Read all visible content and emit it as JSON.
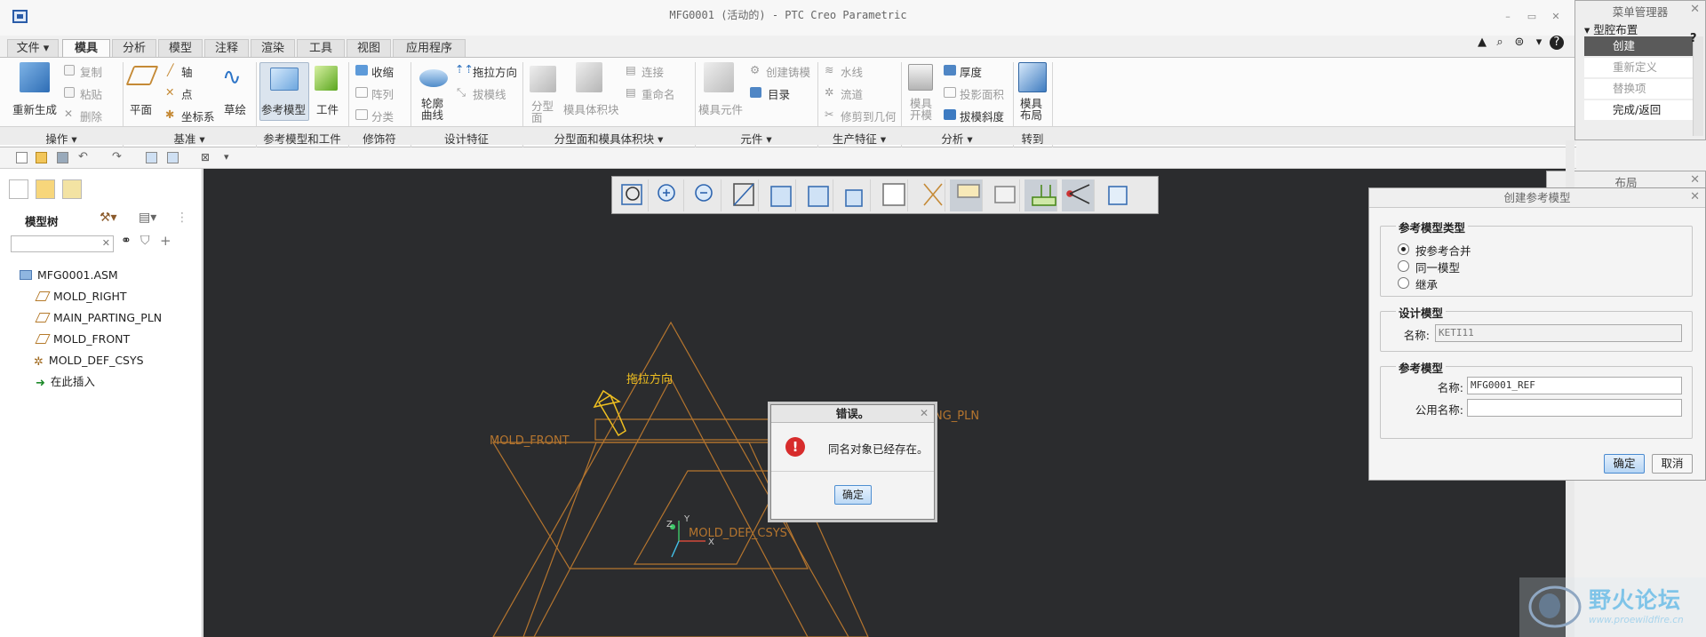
{
  "window": {
    "title": "MFG0001 (活动的) - PTC Creo Parametric"
  },
  "tabs": [
    "文件",
    "模具",
    "分析",
    "模型",
    "注释",
    "渲染",
    "工具",
    "视图",
    "应用程序"
  ],
  "ribbon": {
    "operations": {
      "regenerate": "重新生成",
      "copy": "复制",
      "paste": "粘贴",
      "delete": "删除"
    },
    "datum": {
      "plane": "平面",
      "axis": "轴",
      "point": "点",
      "csys": "坐标系",
      "sketch": "草绘"
    },
    "ref_model": {
      "ref_model": "参考模型",
      "workpiece": "工件"
    },
    "modifiers": {
      "shrink": "收缩",
      "pattern": "阵列",
      "classify": "分类"
    },
    "design_features": {
      "silhouette": "轮廓曲线",
      "pull_direction": "拖拉方向",
      "draft_line": "拔模线"
    },
    "parting": {
      "parting_surface": "分型面",
      "mold_volume": "模具体积块",
      "connect": "连接",
      "rename": "重命名"
    },
    "components": {
      "mold_component": "模具元件",
      "create_casting": "创建铸模",
      "catalog": "目录"
    },
    "production": {
      "waterline": "水线",
      "runner": "流道",
      "trim_geometry": "修剪到几何"
    },
    "analysis": {
      "mold_open": "模具开模",
      "thickness": "厚度",
      "projected_area": "投影面积",
      "draft_check": "拔模斜度"
    },
    "goto": {
      "mold_layout": "模具布局"
    },
    "groups": [
      "操作",
      "基准",
      "参考模型和工件",
      "修饰符",
      "设计特征",
      "分型面和模具体积块",
      "元件",
      "生产特征",
      "分析",
      "转到"
    ]
  },
  "model_tree": {
    "label": "模型树",
    "items": [
      {
        "name": "MFG0001.ASM",
        "type": "asm"
      },
      {
        "name": "MOLD_RIGHT",
        "type": "plane"
      },
      {
        "name": "MAIN_PARTING_PLN",
        "type": "plane"
      },
      {
        "name": "MOLD_FRONT",
        "type": "plane"
      },
      {
        "name": "MOLD_DEF_CSYS",
        "type": "csys"
      },
      {
        "name": "在此插入",
        "type": "insert"
      }
    ]
  },
  "viewport_labels": {
    "pull_direction": "拖拉方向",
    "parting_pln": "NG_PLN",
    "mold_front": "MOLD_FRONT",
    "csys": "MOLD_DEF_CSYS",
    "axis_x": "X",
    "axis_y": "Y",
    "axis_z": "Z"
  },
  "error_dialog": {
    "title": "错误。",
    "message": "同名对象已经存在。",
    "ok": "确定"
  },
  "menu_manager": {
    "title": "菜单管理器",
    "section": "型腔布置",
    "items": [
      "创建",
      "重新定义",
      "替换项",
      "完成/返回"
    ]
  },
  "layout_dialog": {
    "title": "布局"
  },
  "create_ref_model": {
    "title": "创建参考模型",
    "type_label": "参考模型类型",
    "options": [
      "按参考合并",
      "同一模型",
      "继承"
    ],
    "design_model_label": "设计模型",
    "design_name_label": "名称:",
    "design_name_value": "KETI11",
    "ref_model_label": "参考模型",
    "ref_name_label": "名称:",
    "ref_name_value": "MFG0001_REF",
    "common_name_label": "公用名称:",
    "common_name_value": "",
    "ok": "确定",
    "cancel": "取消"
  },
  "watermark": {
    "text": "野火论坛",
    "url": "www.proewildfire.cn"
  },
  "colors": {
    "viewport_bg": "#2b2c2e",
    "geometry": "#b5752e",
    "highlight": "#f0c020",
    "error_red": "#d72c2c"
  }
}
